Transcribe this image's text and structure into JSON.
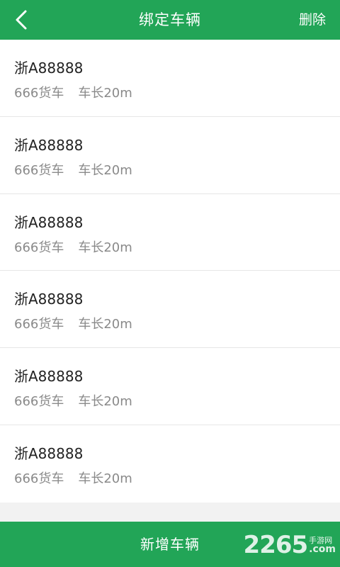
{
  "header": {
    "title": "绑定车辆",
    "action_label": "删除",
    "back_icon": "chevron-left-icon"
  },
  "vehicles": [
    {
      "plate": "浙A88888",
      "type": "666货车",
      "length": "车长20m"
    },
    {
      "plate": "浙A88888",
      "type": "666货车",
      "length": "车长20m"
    },
    {
      "plate": "浙A88888",
      "type": "666货车",
      "length": "车长20m"
    },
    {
      "plate": "浙A88888",
      "type": "666货车",
      "length": "车长20m"
    },
    {
      "plate": "浙A88888",
      "type": "666货车",
      "length": "车长20m"
    },
    {
      "plate": "浙A88888",
      "type": "666货车",
      "length": "车长20m"
    }
  ],
  "footer": {
    "add_label": "新增车辆"
  },
  "watermark": {
    "main": "2265",
    "cn": "手游网",
    "com": ".com"
  },
  "colors": {
    "brand_green": "#22a557",
    "primary_text": "#222222",
    "secondary_text": "#8a8a8a",
    "divider": "#e6e6e6",
    "background": "#f2f2f2"
  }
}
